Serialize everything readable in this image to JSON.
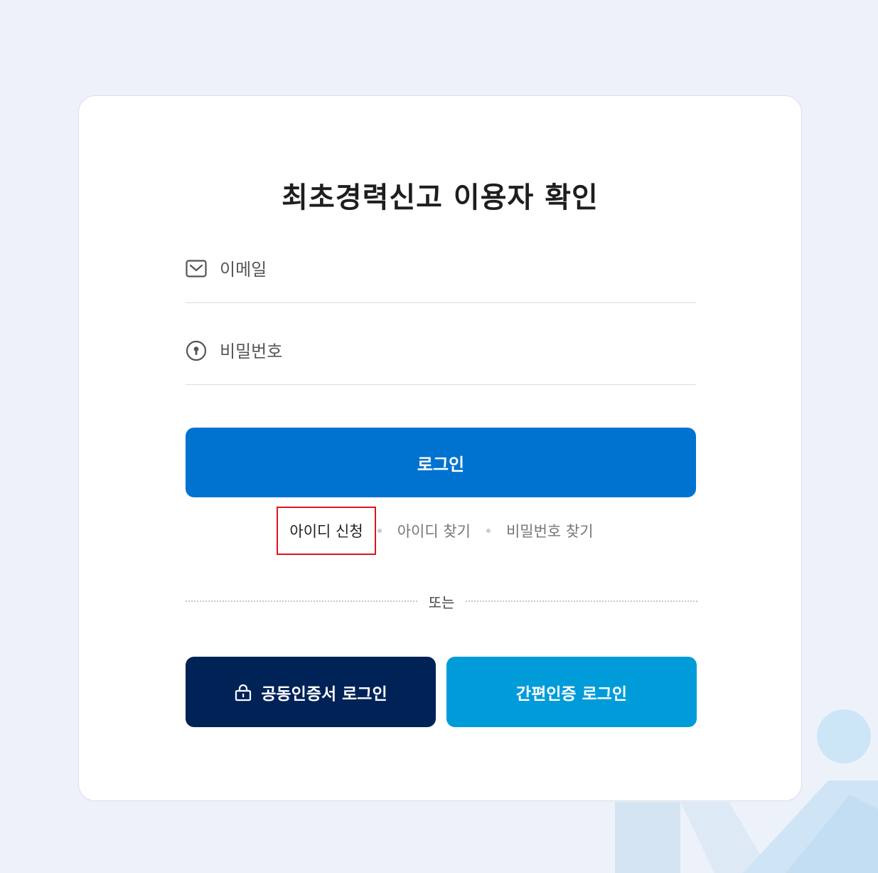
{
  "title": "최초경력신고 이용자 확인",
  "form": {
    "email": {
      "placeholder": "이메일",
      "icon": "mail-icon"
    },
    "password": {
      "placeholder": "비밀번호",
      "icon": "keyhole-icon"
    },
    "login_label": "로그인"
  },
  "links": {
    "signup": "아이디 신청",
    "find_id": "아이디 찾기",
    "find_password": "비밀번호 찾기"
  },
  "divider_label": "또는",
  "alt_login": {
    "certificate": "공동인증서 로그인",
    "simple_auth": "간편인증 로그인"
  },
  "colors": {
    "background": "#edf2fa",
    "primary": "#0073d0",
    "navy": "#002357",
    "sky": "#009cda",
    "highlight_border": "#e0141b"
  }
}
